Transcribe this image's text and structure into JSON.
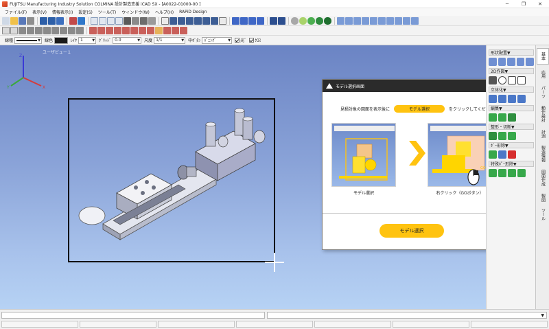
{
  "window": {
    "title": "FUJITSU Manufacturing Industry Solution COLMINA 設計製造支援 iCAD SX - [A0022-01000-00 ]",
    "minimize_label": "─",
    "maximize_label": "❐",
    "close_label": "✕"
  },
  "menu": {
    "items": [
      {
        "label": "ファイル(F)"
      },
      {
        "label": "表示(V)"
      },
      {
        "label": "情報表示(I)"
      },
      {
        "label": "設定(S)"
      },
      {
        "label": "ツール(T)"
      },
      {
        "label": "ウィンドウ(W)"
      },
      {
        "label": "ヘルプ(H)"
      },
      {
        "label": "RAPiD Design"
      }
    ]
  },
  "propbar": {
    "line_type_label": "線種",
    "line_color_label": "線色",
    "layer_label": "ﾚｲﾔ",
    "layer_value": "1",
    "grid_label": "ｸﾞﾘｯﾄﾞ",
    "grid_value": "0.0",
    "scale_label": "尺度",
    "scale_value": "1/1",
    "middle_button_label": "中ﾎﾞﾀﾝ",
    "middle_button_value": "ﾊﾟﾆﾝｸﾞ",
    "snap_label": "光ﾞ",
    "cross_label": "ｸﾛｽ"
  },
  "viewport": {
    "title": "ユーザビュー１",
    "axis_x": "X",
    "axis_y": "Y",
    "axis_z": "Z"
  },
  "dialog": {
    "title": "モデル選択画面",
    "instruction_prefix": "見積対象の図面を表示後に",
    "instruction_pill": "モデル選択",
    "instruction_suffix": "をクリックしてください",
    "left_caption": "モデル選択",
    "right_caption": "右クリック（GOボタン）",
    "button_label": "モデル選択",
    "close_label": "×"
  },
  "rpanel": {
    "sections": [
      {
        "label": "形状配置▼"
      },
      {
        "label": "2D作図▼"
      },
      {
        "label": "立体化▼"
      },
      {
        "label": "編集▼"
      },
      {
        "label": "整形・切断▼"
      },
      {
        "label": "ﾎﾟｰ形除▼"
      },
      {
        "label": "特殊ﾎﾟｰ形除▼"
      }
    ]
  },
  "vtabs": [
    {
      "label": "基本"
    },
    {
      "label": "応用"
    },
    {
      "label": "パーツ"
    },
    {
      "label": "動作設計"
    },
    {
      "label": "計測"
    },
    {
      "label": "製造情報"
    },
    {
      "label": "図面作成"
    },
    {
      "label": "製図"
    },
    {
      "label": "ツール"
    }
  ],
  "colors": {
    "accent_yellow": "#ffc310",
    "dialog_header": "#2b2b2b",
    "viewport_top": "#6b84c4",
    "viewport_bottom": "#b6d2f4"
  }
}
